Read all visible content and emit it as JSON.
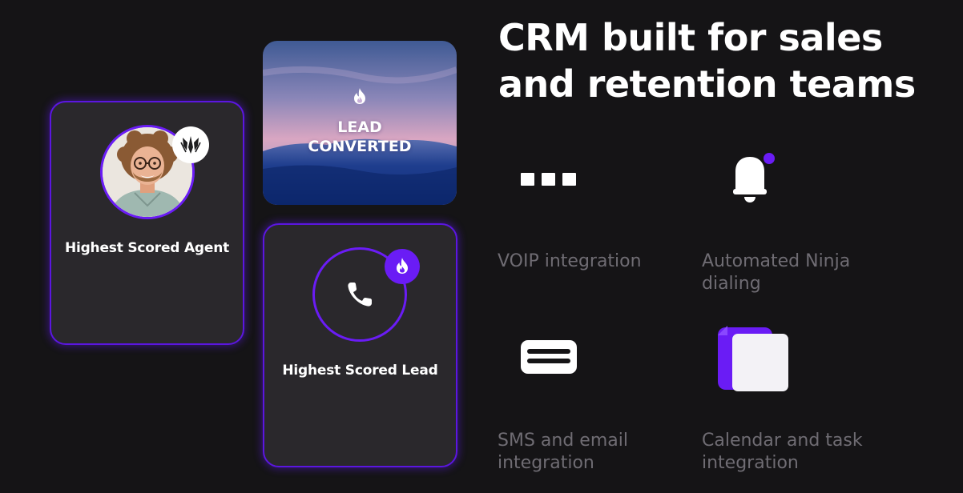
{
  "headline": {
    "line1": "CRM built for sales",
    "line2": "and retention teams"
  },
  "cards": {
    "agent": {
      "title": "Highest Scored Agent",
      "avatar_icon": "agent-avatar",
      "badge_icon": "brand-logo-icon"
    },
    "converted": {
      "line1": "LEAD",
      "line2": "CONVERTED",
      "icon": "fire-icon"
    },
    "lead": {
      "title": "Highest Scored Lead",
      "icon": "phone-icon",
      "badge_icon": "fire-icon"
    }
  },
  "features": [
    {
      "label": "VOIP integration",
      "icon": "voip-dots-icon"
    },
    {
      "label": "Automated Ninja dialing",
      "icon": "bell-icon"
    },
    {
      "label": "SMS and email integration",
      "icon": "message-icon"
    },
    {
      "label": "Calendar and task integration",
      "icon": "documents-icon"
    }
  ],
  "colors": {
    "background": "#151416",
    "card": "#2a282c",
    "accent": "#6a1cf5",
    "feature_text": "#6f6c73",
    "headline_text": "#ffffff"
  }
}
